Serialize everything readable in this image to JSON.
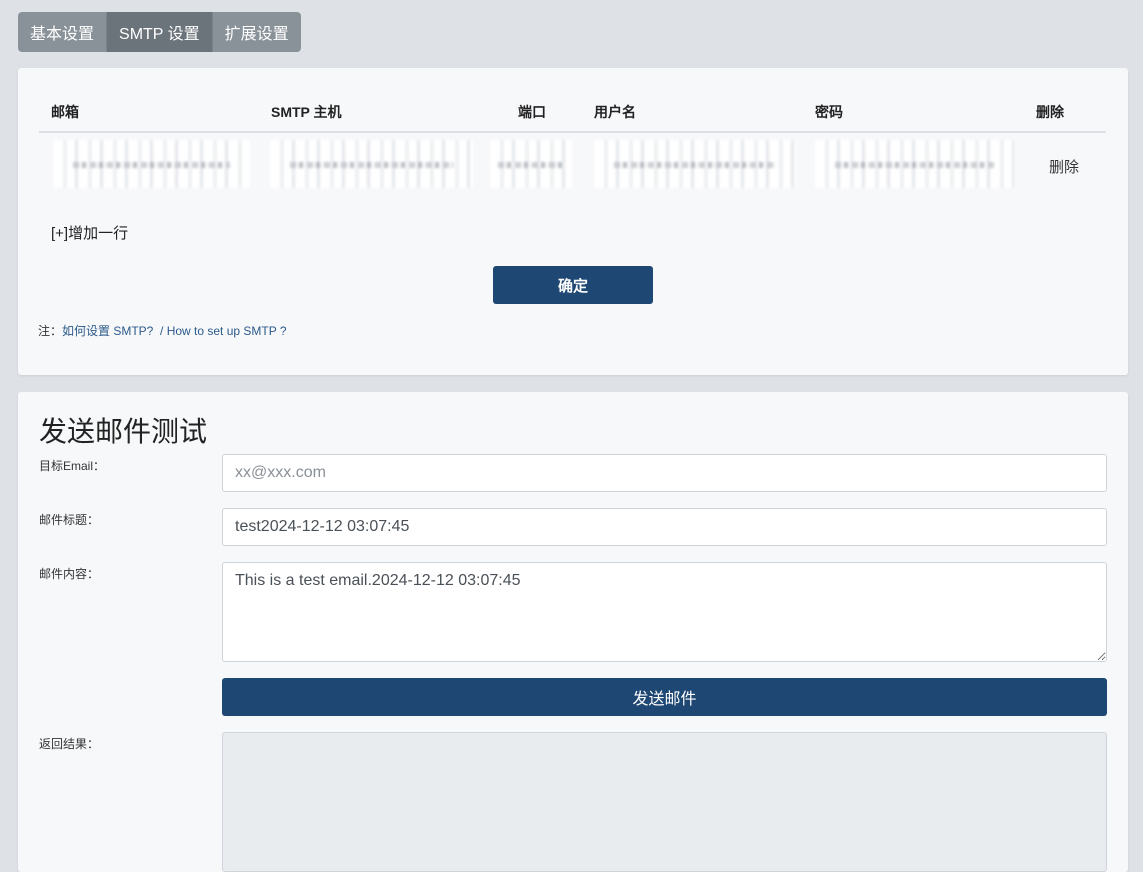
{
  "tabs": [
    {
      "label": "基本设置"
    },
    {
      "label": "SMTP 设置"
    },
    {
      "label": "扩展设置"
    }
  ],
  "smtp_table": {
    "headers": [
      "邮箱",
      "SMTP 主机",
      "端口",
      "用户名",
      "密码",
      "删除"
    ],
    "rows": [
      {
        "delete_label": "删除"
      }
    ],
    "add_row_label": "[+]增加一行",
    "confirm_label": "确定",
    "note_prefix": "注：",
    "help_link_cn": "如何设置 SMTP?",
    "help_link_en": "/ How to set up SMTP ?"
  },
  "test_section": {
    "title": "发送邮件测试",
    "target_label": "目标Email：",
    "target_placeholder": "xx@xxx.com",
    "subject_label": "邮件标题：",
    "subject_value": "test2024-12-12 03:07:45",
    "content_label": "邮件内容：",
    "content_value": "This is a test email.2024-12-12 03:07:45",
    "send_label": "发送邮件",
    "result_label": "返回结果："
  }
}
